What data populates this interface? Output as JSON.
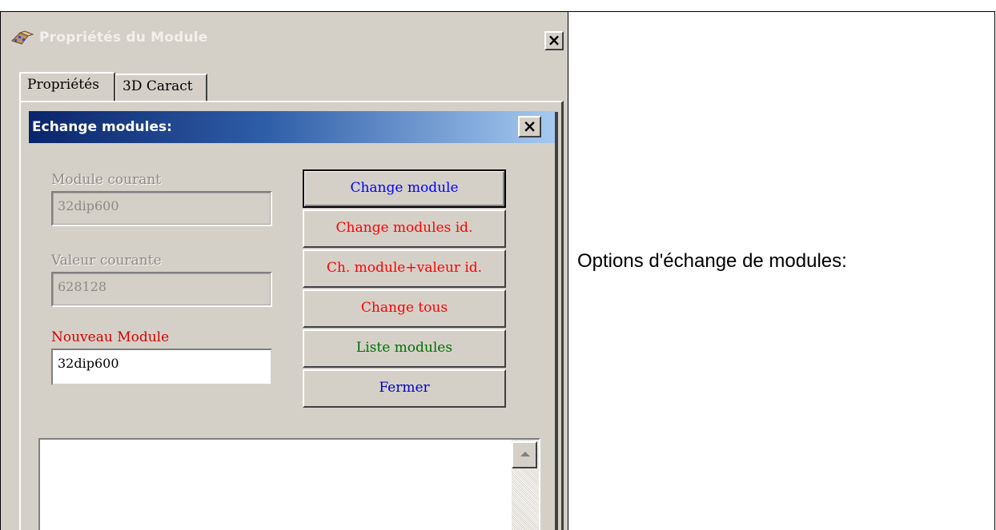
{
  "window": {
    "title": "Propriétés du Module",
    "close_label": "×"
  },
  "tabs": [
    {
      "label": "Propriétés"
    },
    {
      "label": "3D Caract"
    }
  ],
  "dialog": {
    "title": "Echange modules:",
    "close_label": "×",
    "current_module": {
      "label": "Module courant",
      "value": "32dip600"
    },
    "current_value": {
      "label": "Valeur courante",
      "value": "628128"
    },
    "new_module": {
      "label": "Nouveau Module",
      "value": "32dip600"
    },
    "buttons": [
      {
        "label": "Change module",
        "color": "#0000ff"
      },
      {
        "label": "Change modules id.",
        "color": "#ff0000"
      },
      {
        "label": "Ch. module+valeur id.",
        "color": "#ff0000"
      },
      {
        "label": "Change tous",
        "color": "#ff0000"
      },
      {
        "label": "Liste modules",
        "color": "#007000"
      },
      {
        "label": "Fermer",
        "color": "#0000c8"
      }
    ]
  },
  "caption": "Options d'échange de modules:",
  "icons": {
    "window_icon": "pcb-module-icon",
    "scroll_up": "scroll-up-arrow-icon"
  }
}
